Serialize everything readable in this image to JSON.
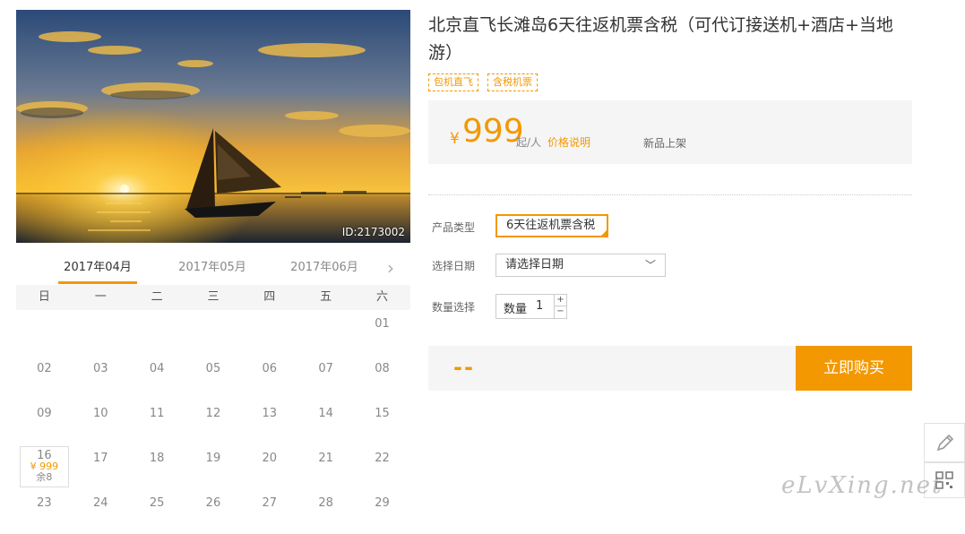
{
  "hero": {
    "id_label": "ID:2173002"
  },
  "months": {
    "tabs": [
      "2017年04月",
      "2017年05月",
      "2017年06月"
    ],
    "next": "›"
  },
  "calendar": {
    "weekdays": [
      "日",
      "一",
      "二",
      "三",
      "四",
      "五",
      "六"
    ],
    "rows": [
      [
        "",
        "",
        "",
        "",
        "",
        "",
        "01"
      ],
      [
        "02",
        "03",
        "04",
        "05",
        "06",
        "07",
        "08"
      ],
      [
        "09",
        "10",
        "11",
        "12",
        "13",
        "14",
        "15"
      ],
      [
        "16",
        "17",
        "18",
        "19",
        "20",
        "21",
        "22"
      ],
      [
        "23",
        "24",
        "25",
        "26",
        "27",
        "28",
        "29"
      ]
    ],
    "available": {
      "day": "16",
      "price": "¥ 999",
      "left": "余8"
    }
  },
  "product": {
    "title": "北京直飞长滩岛6天往返机票含税（可代订接送机+酒店+当地游）",
    "tags": [
      "包机直飞",
      "含税机票"
    ]
  },
  "price": {
    "currency": "¥",
    "amount": "999",
    "unit": "起/人",
    "desc_link": "价格说明",
    "badge": "新品上架"
  },
  "form": {
    "type_label": "产品类型",
    "type_value": "6天往返机票含税",
    "date_label": "选择日期",
    "date_placeholder": "请选择日期",
    "qty_label": "数量选择",
    "qty_inner_label": "数量",
    "qty_value": "1",
    "qty_plus": "+",
    "qty_minus": "−"
  },
  "total": {
    "value": "--",
    "buy_label": "立即购买"
  },
  "watermark": "eLvXing.net",
  "colors": {
    "accent": "#f39800",
    "panel": "#f5f5f5"
  },
  "icons": {
    "edit": "pencil-icon",
    "qr": "qrcode-icon"
  }
}
